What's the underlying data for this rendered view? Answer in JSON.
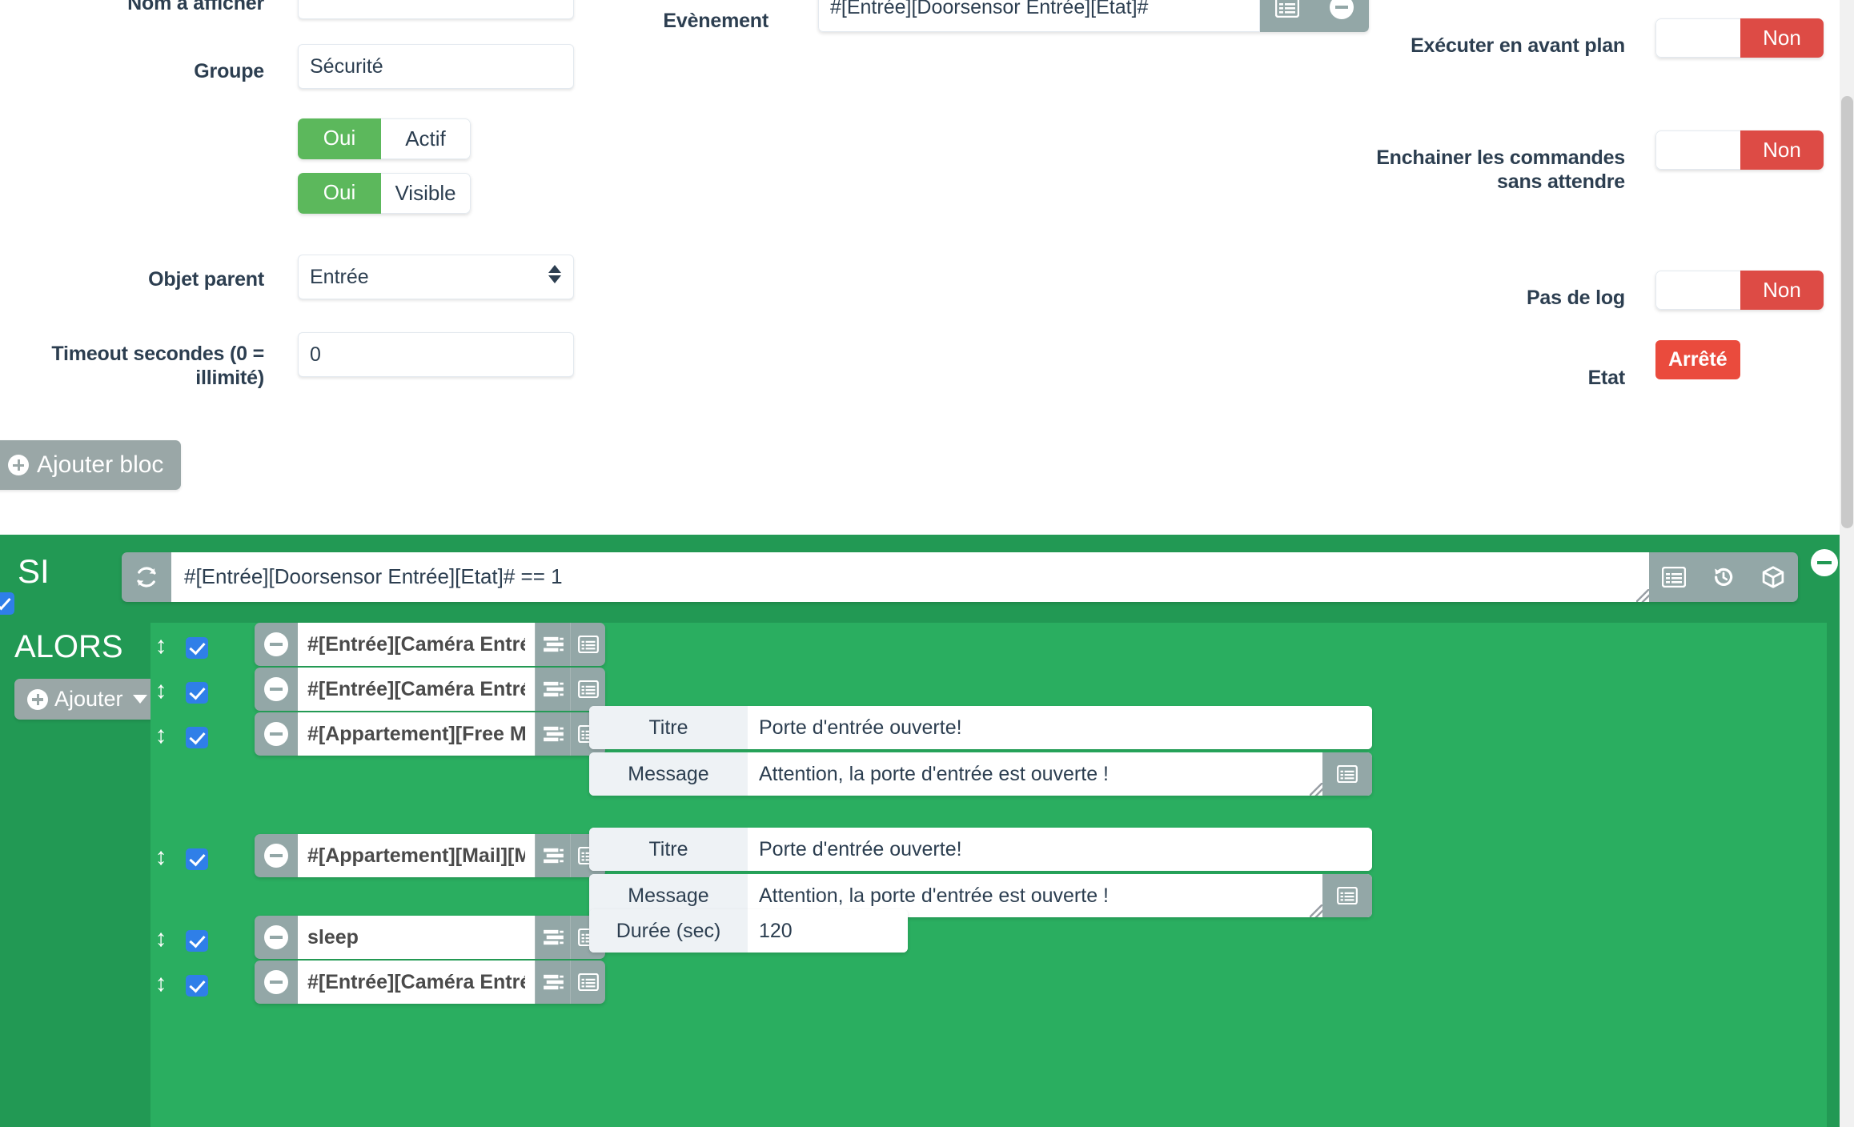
{
  "form": {
    "nom_label": "Nom à afficher",
    "nom_value": "",
    "nom_placeholder": "",
    "groupe_label": "Groupe",
    "groupe_value": "Sécurité",
    "actif_state": "Oui",
    "actif_label": "Actif",
    "visible_state": "Oui",
    "visible_label": "Visible",
    "parent_label": "Objet parent",
    "parent_value": "Entrée",
    "timeout_label": "Timeout secondes (0 = illimité)",
    "timeout_value": "0",
    "event_label": "Evènement",
    "event_value": "#[Entrée][Doorsensor Entrée][Etat]#",
    "avant_plan_label": "Exécuter en avant plan",
    "avant_plan_state": "Non",
    "enchainer_label": "Enchainer les commandes sans attendre",
    "enchainer_state": "Non",
    "pas_de_log_label": "Pas de log",
    "pas_de_log_state": "Non",
    "etat_label": "Etat",
    "etat_value": "Arrêté",
    "ajouter_bloc_label": "Ajouter bloc"
  },
  "scenario": {
    "si_label": "SI",
    "si_expression": "#[Entrée][Doorsensor Entrée][Etat]# == 1",
    "alors_label": "ALORS",
    "ajouter_label": "Ajouter",
    "actions": [
      {
        "command": "#[Entrée][Caméra Entrée][Start]#",
        "params": []
      },
      {
        "command": "#[Entrée][Caméra Entrée][Snapshot]#",
        "params": []
      },
      {
        "command": "#[Appartement][Free Mobile][Alerte]#",
        "params": [
          {
            "label": "Titre",
            "value": "Porte d'entrée ouverte!",
            "type": "text"
          },
          {
            "label": "Message",
            "value": "Attention, la porte d'entrée est ouverte !",
            "type": "textarea"
          }
        ]
      },
      {
        "command": "#[Appartement][Mail][Mathias]#",
        "params": [
          {
            "label": "Titre",
            "value": "Porte d'entrée ouverte!",
            "type": "text"
          },
          {
            "label": "Message",
            "value": "Attention, la porte d'entrée est ouverte !",
            "type": "textarea"
          }
        ]
      },
      {
        "command": "sleep",
        "params": [
          {
            "label": "Durée (sec)",
            "value": "120",
            "type": "text"
          }
        ]
      },
      {
        "command": "#[Entrée][Caméra Entrée][Stop]#",
        "params": []
      }
    ]
  },
  "colors": {
    "accent_green": "#229954",
    "panel_green": "#2aae60",
    "toggle_on": "#5cb85c",
    "toggle_off": "#dd4b45",
    "status_red": "#ea4b3d",
    "button_grey": "#9aa7a7",
    "label_navy": "#2c3e50",
    "checkbox_blue": "#2f7fe8"
  }
}
